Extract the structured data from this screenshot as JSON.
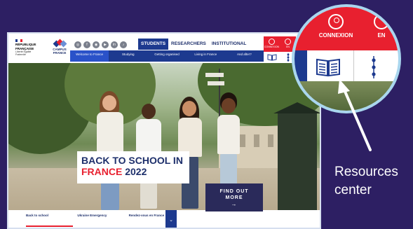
{
  "site": {
    "logo_rf": {
      "line1": "RÉPUBLIQUE",
      "line2": "FRANÇAISE",
      "motto": "Liberté Égalité Fraternité"
    },
    "logo_cf": {
      "line1": "CAMPUS",
      "line2": "FRANCE"
    }
  },
  "social": [
    "◎",
    "f",
    "◉",
    "▶",
    "in",
    "♪"
  ],
  "tabs": [
    {
      "label": "STUDENTS",
      "active": true
    },
    {
      "label": "RESEARCHERS",
      "active": false
    },
    {
      "label": "INSTITUTIONAL",
      "active": false
    }
  ],
  "nav": [
    {
      "label": "Welcome to France",
      "selected": true
    },
    {
      "label": "Studying",
      "selected": false
    },
    {
      "label": "Getting organised",
      "selected": false
    },
    {
      "label": "Living in France",
      "selected": false
    },
    {
      "label": "And after?",
      "selected": false
    }
  ],
  "topright": {
    "connexion": "CONNEXION",
    "lang": "EN"
  },
  "hero": {
    "title_line1": "BACK TO SCHOOL IN",
    "title_line2_red": "FRANCE",
    "title_line2_rest": " 2022",
    "cta_line1": "FIND OUT",
    "cta_line2": "MORE",
    "cta_arrow": "→"
  },
  "bottom_tabs": [
    {
      "label": "Back to school",
      "active": true
    },
    {
      "label": "Ukraine Emergency",
      "active": false
    },
    {
      "label": "Rendez-vous en France",
      "active": false
    }
  ],
  "bottom_chevron": "⌄",
  "zoom": {
    "connexion": "CONNEXION",
    "lang": "EN"
  },
  "annotation": {
    "line1": "Resources",
    "line2": "center"
  },
  "colors": {
    "background": "#2d1f63",
    "red": "#e8202f",
    "blue": "#1d3a8f",
    "navy": "#1d2f6b"
  }
}
